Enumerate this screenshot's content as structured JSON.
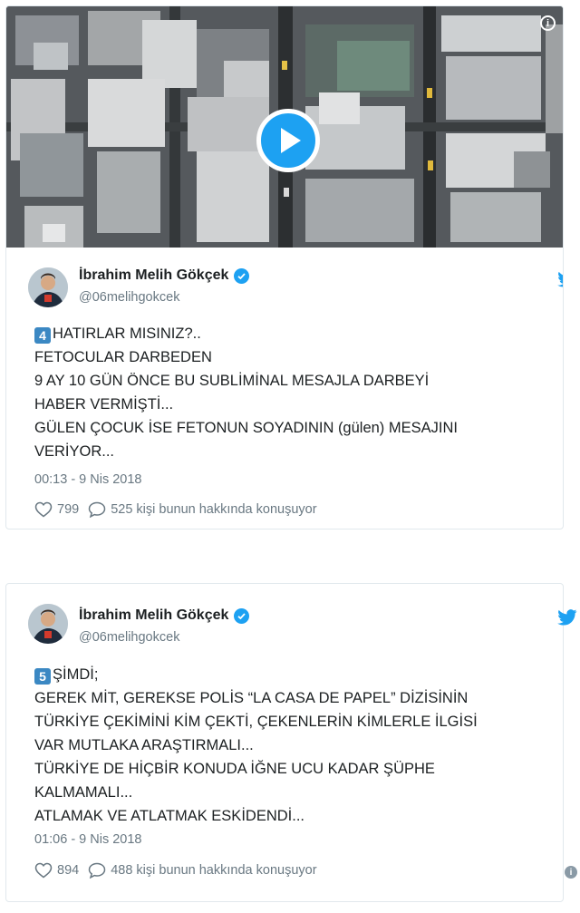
{
  "tweets": [
    {
      "author_name": "İbrahim Melih Gökçek",
      "handle": "@06melihgokcek",
      "number_badge": "4",
      "lines": [
        "HATIRLAR MISINIZ?..",
        "FETOCULAR DARBEDEN",
        "9 AY 10 GÜN ÖNCE BU SUBLİMİNAL MESAJLA DARBEYİ",
        "HABER VERMİŞTİ...",
        "GÜLEN ÇOCUK İSE FETONUN SOYADININ (gülen) MESAJINI",
        "VERİYOR..."
      ],
      "timestamp": "00:13 - 9 Nis 2018",
      "likes": "799",
      "replies": "525 kişi bunun hakkında konuşuyor"
    },
    {
      "author_name": "İbrahim Melih Gökçek",
      "handle": "@06melihgokcek",
      "number_badge": "5",
      "lines": [
        "ŞİMDİ;",
        "GEREK MİT, GEREKSE POLİS “LA CASA DE PAPEL” DİZİSİNİN",
        "TÜRKİYE ÇEKİMİNİ KİM ÇEKTİ, ÇEKENLERİN KİMLERLE İLGİSİ",
        "VAR MUTLAKA ARAŞTIRMALI...",
        "TÜRKİYE DE HİÇBİR KONUDA İĞNE UCU KADAR ŞÜPHE",
        "KALMAMALI...",
        "ATLAMAK VE ATLATMAK ESKİDENDİ..."
      ],
      "timestamp": "01:06 - 9 Nis 2018",
      "likes": "894",
      "replies": "488 kişi bunun hakkında konuşuyor"
    }
  ],
  "icons": {
    "play": "play-icon",
    "info": "info-icon",
    "verified": "verified-icon",
    "bird": "twitter-bird-icon",
    "like": "heart-icon",
    "reply": "reply-bubble-icon"
  },
  "colors": {
    "accent": "#1da1f2",
    "text": "#1c2022",
    "muted": "#697882",
    "border": "#e1e8ed",
    "keycap": "#3b88c3"
  }
}
